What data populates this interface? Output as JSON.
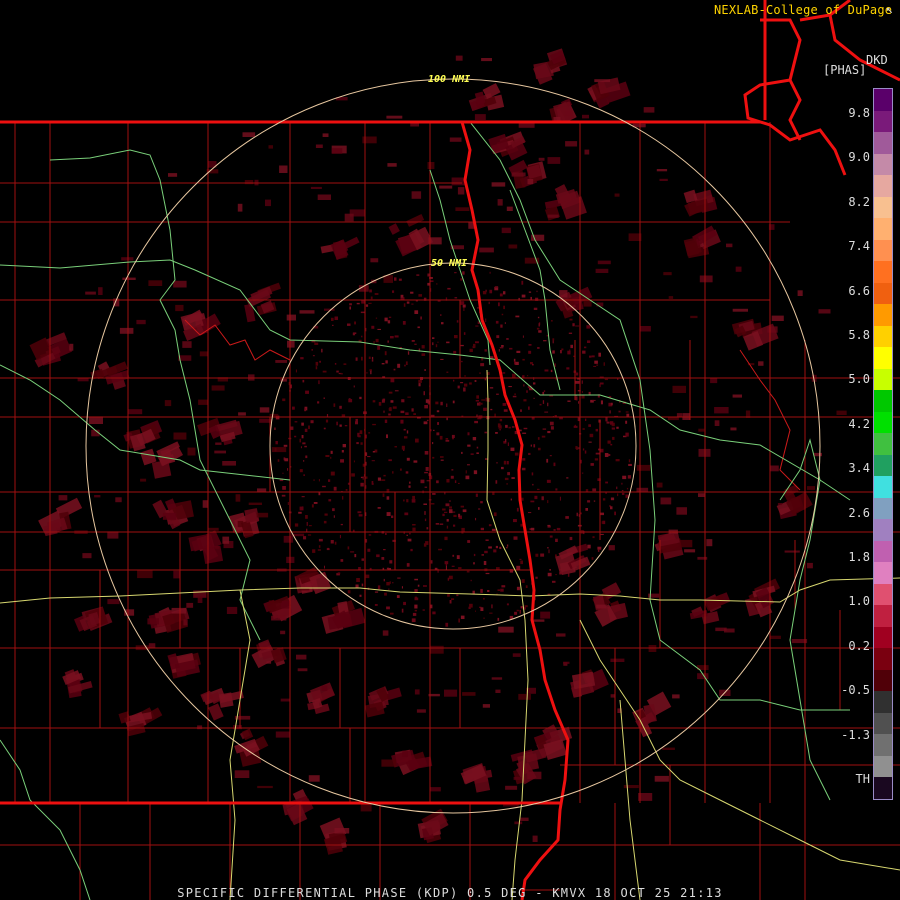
{
  "credit": "NEXLAB-College of DuPage",
  "product_code": "DKD",
  "units": "[PHAS]",
  "range_rings": [
    "100 NMI",
    "50 NMI"
  ],
  "footer": "SPECIFIC DIFFERENTIAL PHASE (KDP) 0.5 DEG - KMVX 18 OCT 25 21:13",
  "legend": {
    "ticks": [
      "9.8",
      "9.0",
      "8.2",
      "7.4",
      "6.6",
      "5.8",
      "5.0",
      "4.2",
      "3.4",
      "2.6",
      "1.8",
      "1.0",
      "0.2",
      "-0.5",
      "-1.3",
      "TH"
    ],
    "colors": [
      "#5a006a",
      "#7a1a7a",
      "#a05a9a",
      "#c48aa8",
      "#e6a8a0",
      "#f8c090",
      "#ffb070",
      "#ff9050",
      "#ff7020",
      "#f06010",
      "#ff9a00",
      "#ffd000",
      "#ffff00",
      "#c8ff00",
      "#00c800",
      "#00e000",
      "#40c040",
      "#20a060",
      "#40e0e0",
      "#80a0c0",
      "#a080c0",
      "#c060b0",
      "#e080c0",
      "#e05070",
      "#c02040",
      "#a00020",
      "#7a0010",
      "#500008",
      "#303030",
      "#505050",
      "#707070",
      "#909090",
      "#1a0820"
    ]
  }
}
